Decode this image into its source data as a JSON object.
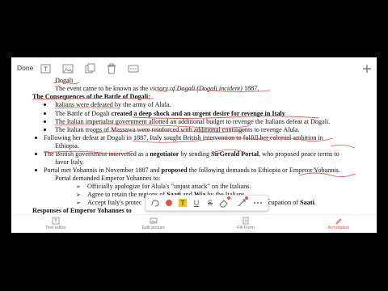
{
  "topbar": {
    "done_label": "Done",
    "icons": [
      "text-edit-icon",
      "image-icon",
      "copy-pages-icon",
      "trash-icon",
      "more-icon",
      "add-icon"
    ]
  },
  "document": {
    "cut_line_1": "Dogali",
    "line_event": "The event came to be known as the ",
    "line_event_italic": "victory of Dogali",
    "line_event_italic2": " (Dogali incident)",
    "line_event_end": " 1887.",
    "heading_consequences": "The Consequences of the Battle of Dogali:",
    "bullets": [
      "Italians were defeated by the army of Alula.",
      "The Battle of Dogali ",
      "The Italian imperialist government allotted an additional budget to revenge the Italians defeat at Dogali.",
      "The Italian troops of Massawa were reinforced with additional contingents to revenge Alula."
    ],
    "bullet2_bold": "created a deep shock and an urgent desire for revenge in Italy",
    "bullet5_line1": "Following her defeat at Dogali in 1887, Italy sought British intervention to fulfill her colonial ambition in",
    "bullet5_line2": "Ethiopia.",
    "bullet6_a": "The British government intervened as a ",
    "bullet6_b": "negotiator",
    "bullet6_c": " by sending ",
    "bullet6_d": "SirGerald Portal",
    "bullet6_e": ", who proposed peace terms to",
    "bullet6_line2": "favor Italy.",
    "bullet7_a": "Portal met Yohannis in November 1887 and ",
    "bullet7_b": "proposed",
    "bullet7_c": " the following demands to Ethiopia or Emperor Yohannis.",
    "bullet7_line2": "Portal demanded Emperor Yohannes to:",
    "sub_items": [
      "Officially apologize for Alula's \"unjust attack\" on the Italians.",
      "Agree to retain the regions of ",
      "Accept Italy's protec"
    ],
    "sub2_bold1": "Saati",
    "sub2_and": " and ",
    "sub2_bold2": "Wia",
    "sub2_end": " by the Italians.",
    "sub3_tail": "cupation of ",
    "sub3_tail_bold": "Saati",
    "sub3_tail_end": ".",
    "heading_responses": "Responses of Emperor Yohannes to"
  },
  "annotation_toolbar": {
    "tools": [
      "lasso-icon",
      "pen-icon",
      "highlighter-icon",
      "underline-icon",
      "strikethrough-icon",
      "eraser-icon",
      "shape-icon",
      "more-icon"
    ],
    "highlight_letter": "T",
    "underline_letter": "U",
    "strike_letter": "S"
  },
  "tabbar": {
    "tabs": [
      {
        "label": "Text editor",
        "icon": "text-editor-icon"
      },
      {
        "label": "Edit picture",
        "icon": "edit-picture-icon"
      },
      {
        "label": "Fill Form",
        "icon": "fill-form-icon"
      },
      {
        "label": "Annotation",
        "icon": "annotation-icon"
      }
    ],
    "active": "Annotation"
  },
  "colors": {
    "ink_red": "#d9534f",
    "accent": "#e0524f",
    "highlight_yellow": "#f5c518"
  }
}
